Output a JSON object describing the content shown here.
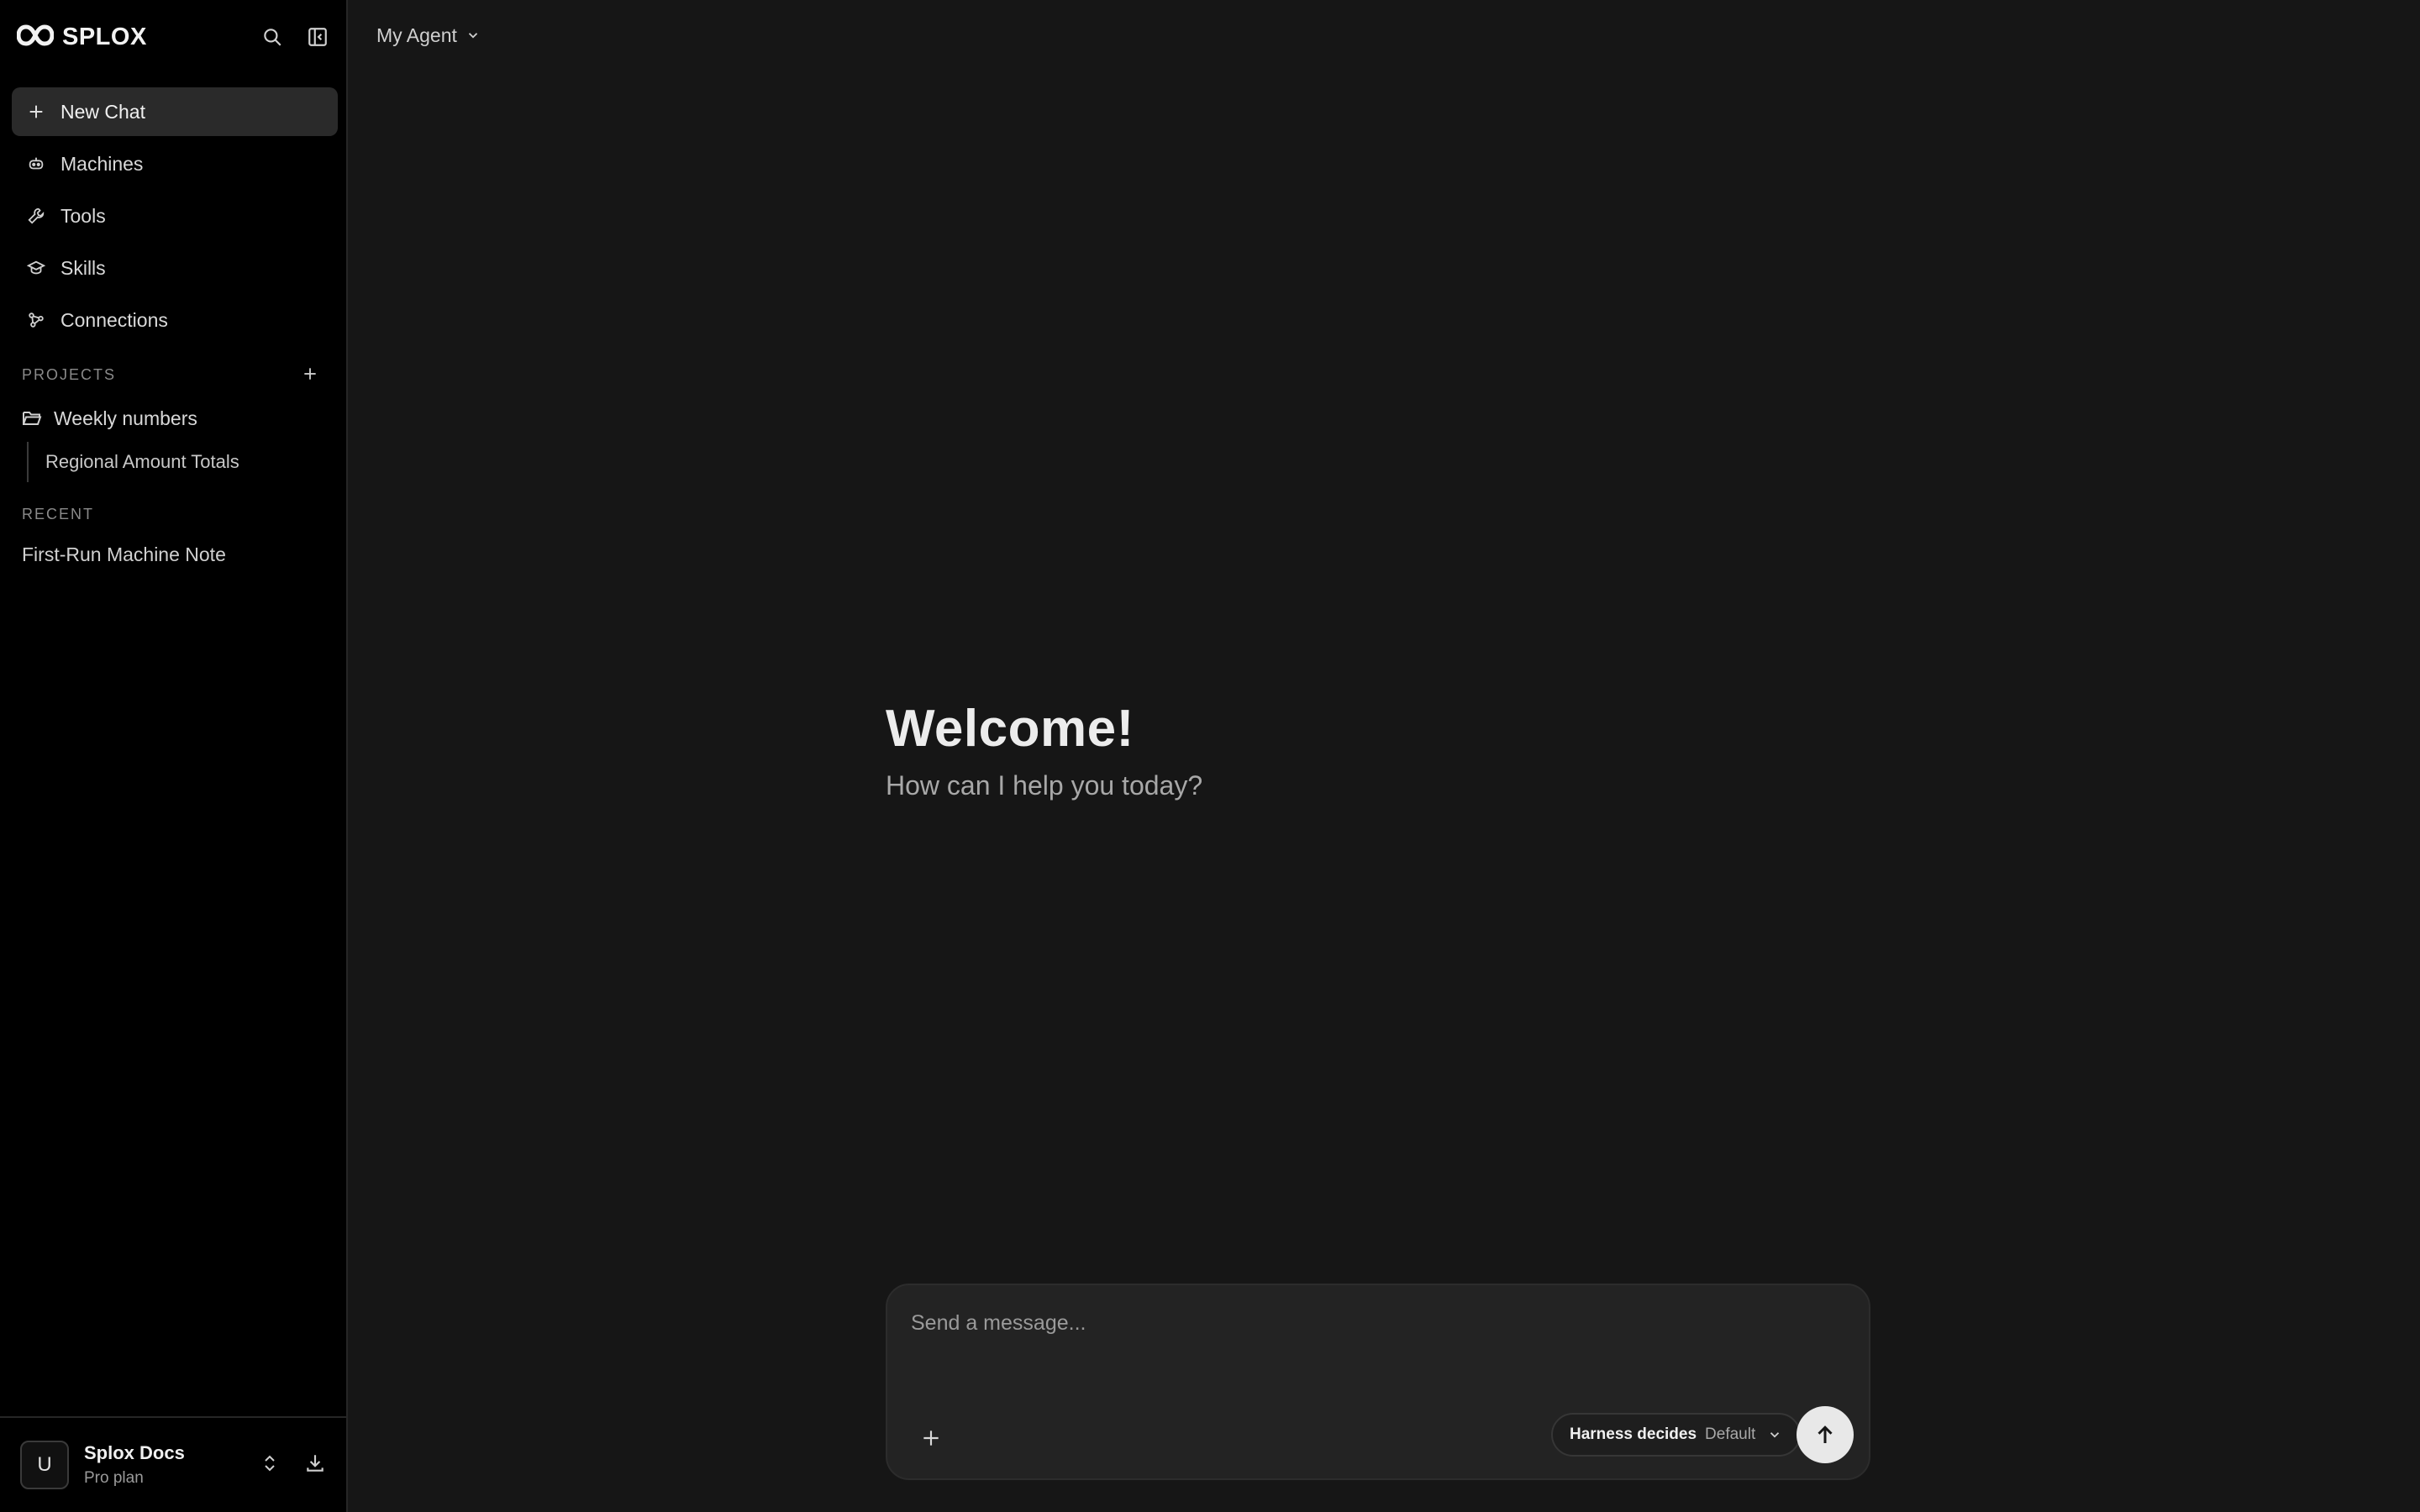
{
  "brand": {
    "name": "SPLOX",
    "logo_icon": "infinity-logo-icon"
  },
  "sidebar": {
    "search_icon": "search-icon",
    "collapse_icon": "sidebar-collapse-icon",
    "nav": [
      {
        "label": "New Chat",
        "icon": "plus-icon",
        "active": true
      },
      {
        "label": "Machines",
        "icon": "robot-icon"
      },
      {
        "label": "Tools",
        "icon": "wrench-icon"
      },
      {
        "label": "Skills",
        "icon": "graduation-cap-icon"
      },
      {
        "label": "Connections",
        "icon": "connections-icon"
      }
    ],
    "projects_label": "PROJECTS",
    "projects": [
      {
        "label": "Weekly numbers",
        "icon": "folder-open-icon",
        "children": [
          "Regional Amount Totals"
        ]
      }
    ],
    "recent_label": "RECENT",
    "recent": [
      "First-Run Machine Note"
    ],
    "user": {
      "initial": "U",
      "name": "Splox Docs",
      "plan": "Pro plan"
    }
  },
  "main": {
    "agent_label": "My Agent",
    "welcome_title": "Welcome!",
    "welcome_subtitle": "How can I help you today?",
    "composer": {
      "placeholder": "Send a message...",
      "model_main": "Harness decides",
      "model_sub": "Default"
    }
  },
  "colors": {
    "sidebar_bg": "#000000",
    "main_bg": "#161616",
    "composer_bg": "#232323",
    "active_item_bg": "#2a2a2a",
    "send_button_bg": "#e8e8e8"
  }
}
